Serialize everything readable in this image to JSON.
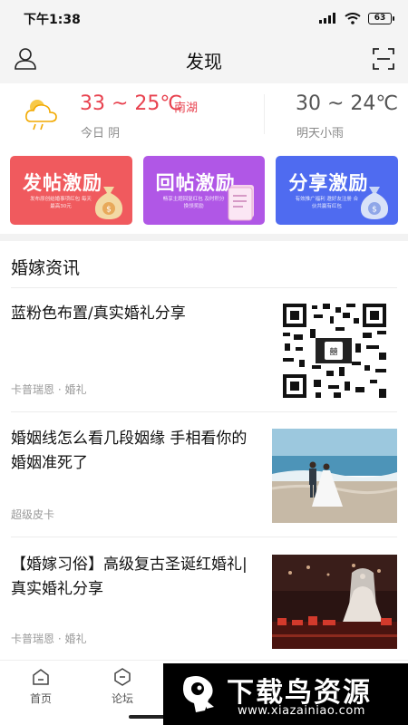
{
  "status_bar": {
    "time": "下午1:38",
    "battery": "63"
  },
  "header": {
    "title": "发现",
    "icons": [
      "user-icon",
      "scan-icon"
    ]
  },
  "weather": {
    "today_temp": "33 ~ 25℃",
    "city": "南湖",
    "today_label": "今日 阴",
    "tomorrow_temp": "30 ~ 24℃",
    "tomorrow_label": "明天小雨",
    "colors": {
      "today": "#e8424f",
      "tomorrow": "#555555"
    }
  },
  "promo_cards": [
    {
      "title": "发帖激励",
      "subtitle": "发布原创结婚事项红包 每天最高30元",
      "color": "#f05a5e",
      "icon": "money-bag-icon"
    },
    {
      "title": "回帖激励",
      "subtitle": "畅享主题回复红包 及时积分换领奖励",
      "color": "#b057e6",
      "icon": "document-icon"
    },
    {
      "title": "分享激励",
      "subtitle": "有效推广福利 邀好友注册 合伙共赢有红包",
      "color": "#4f6bf0",
      "icon": "money-bag-icon"
    }
  ],
  "section": {
    "title": "婚嫁资讯"
  },
  "articles": [
    {
      "title": "蓝粉色布置/真实婚礼分享",
      "meta": "卡普瑞恩 · 婚礼",
      "thumb": "qr-code"
    },
    {
      "title": "婚姻线怎么看几段姻缘 手相看你的婚姻准死了",
      "meta": "超级皮卡",
      "thumb": "beach-wedding-photo"
    },
    {
      "title": "【婚嫁习俗】高级复古圣诞红婚礼|真实婚礼分享",
      "meta": "卡普瑞恩 · 婚礼",
      "thumb": "wedding-hall-photo"
    }
  ],
  "tabbar": {
    "tabs": [
      {
        "label": "首页",
        "icon": "home-icon"
      },
      {
        "label": "论坛",
        "icon": "forum-icon"
      }
    ]
  },
  "watermark": {
    "text": "下载鸟资源",
    "url": "www.xiazainiao.com"
  }
}
